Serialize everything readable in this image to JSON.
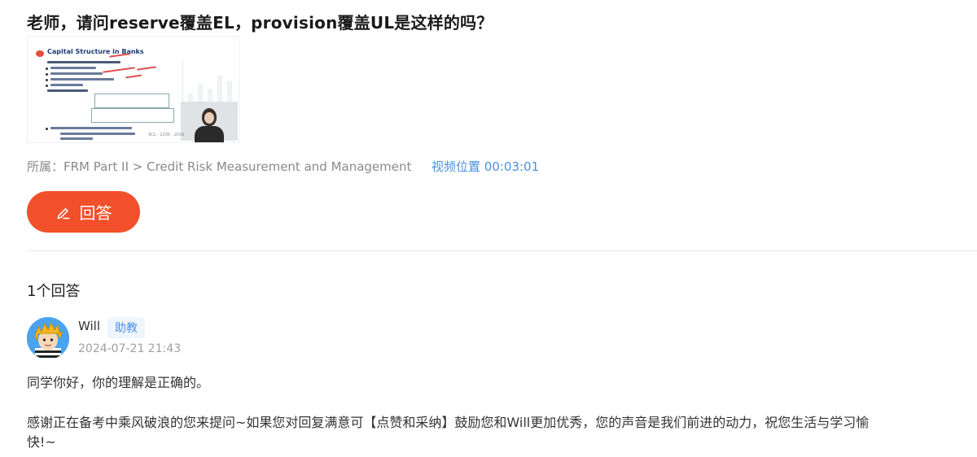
{
  "question": {
    "title": "老师，请问reserve覆盖EL，provision覆盖UL是这样的吗？"
  },
  "thumbnail": {
    "slide_title": "Capital Structure in Banks",
    "slide_footer": "SCL · 1200 · 2016"
  },
  "meta": {
    "breadcrumb": "所属：FRM Part II > Credit Risk Measurement and Management",
    "video_position": "视频位置 00:03:01"
  },
  "answer_button": {
    "label": "回答",
    "icon": "pencil-icon"
  },
  "answers": {
    "count_label": "1个回答",
    "items": [
      {
        "author": "Will",
        "role_badge": "助教",
        "timestamp": "2024-07-21 21:43",
        "text": "同学你好，你的理解是正确的。",
        "closing": "感谢正在备考中乘风破浪的您来提问~如果您对回复满意可【点赞和采纳】鼓励您和Will更加优秀，您的声音是我们前进的动力，祝您生活与学习愉快!~"
      }
    ]
  },
  "colors": {
    "accent": "#f1502a",
    "link": "#4a90e2",
    "badge_bg": "#eef5fd"
  }
}
